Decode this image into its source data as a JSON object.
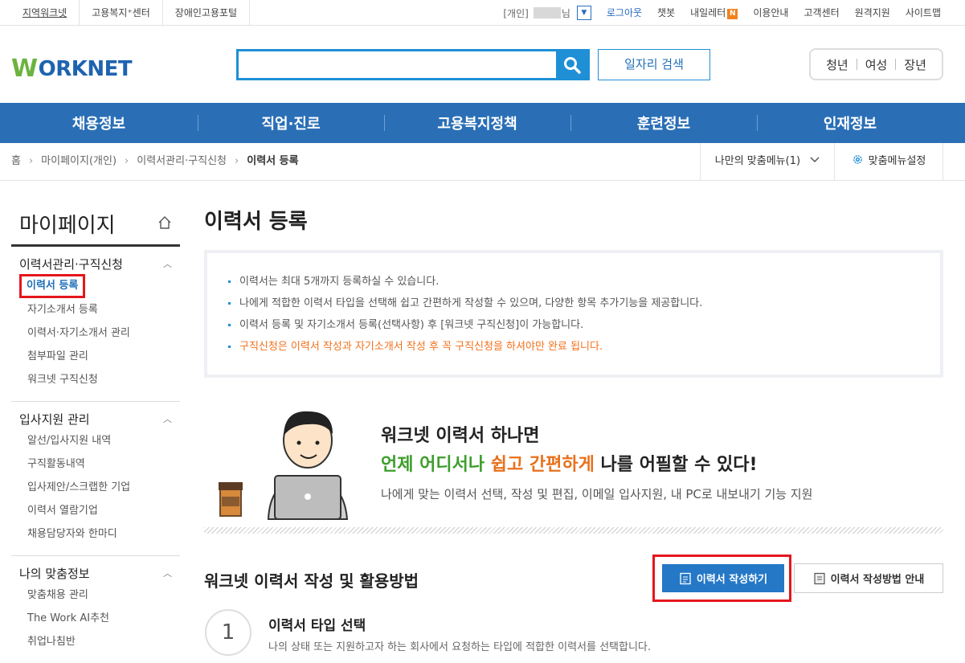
{
  "util": {
    "left_links": [
      "지역워크넷",
      "고용복지⁺센터",
      "장애인고용포털"
    ],
    "user_prefix": "[개인]",
    "user_suffix": "님",
    "logout": "로그아웃",
    "chatbot": "챗봇",
    "naeil": "내일레터",
    "naeil_badge": "N",
    "guide": "이용안내",
    "support": "고객센터",
    "remote": "원격지원",
    "sitemap": "사이트맵"
  },
  "header": {
    "logo_w": "W",
    "logo_rest": "ORKNET",
    "search_placeholder": "",
    "job_search": "일자리 검색",
    "segments": [
      "청년",
      "여성",
      "장년"
    ]
  },
  "gnb": [
    "채용정보",
    "직업·진로",
    "고용복지정책",
    "훈련정보",
    "인재정보"
  ],
  "breadcrumb": {
    "home": "홈",
    "items": [
      "마이페이지(개인)",
      "이력서관리·구직신청"
    ],
    "current": "이력서 등록",
    "my_menu": "나만의 맞춤메뉴(1)",
    "menu_settings": "맞춤메뉴설정"
  },
  "sidebar": {
    "title": "마이페이지",
    "groups": [
      {
        "title": "이력서관리·구직신청",
        "items": [
          "이력서 등록",
          "자기소개서 등록",
          "이력서·자기소개서 관리",
          "첨부파일 관리",
          "워크넷 구직신청"
        ]
      },
      {
        "title": "입사지원 관리",
        "items": [
          "알선/입사지원 내역",
          "구직활동내역",
          "입사제안/스크랩한 기업",
          "이력서 열람기업",
          "채용담당자와 한마디"
        ]
      },
      {
        "title": "나의 맞춤정보",
        "items": [
          "맞춤채용 관리",
          "The Work AI추천",
          "취업나침반"
        ]
      }
    ]
  },
  "main": {
    "title": "이력서 등록",
    "info": [
      "이력서는 최대 5개까지 등록하실 수 있습니다.",
      "나에게 적합한 이력서 타입을 선택해 쉽고 간편하게 작성할 수 있으며, 다양한 항목 추가기능을 제공합니다.",
      "이력서 등록 및 자기소개서 등록(선택사항) 후 [워크넷 구직신청]이 가능합니다."
    ],
    "warning": "구직신청은 이력서 작성과 자기소개서 작성 후 꼭 구직신청을 하셔야만 완료 됩니다.",
    "banner": {
      "line1": "워크넷 이력서 하나면",
      "line2_a": "언제 어디서나",
      "line2_b": " ",
      "line2_c": "쉽고 간편하게",
      "line2_d": " 나를 어필할 수 있다!",
      "line3": "나에게 맞는 이력서 선택, 작성 및 편집, 이메일 입사지원, 내 PC로 내보내기 기능 지원"
    },
    "section_title": "워크넷 이력서 작성 및 활용방법",
    "write_btn": "이력서 작성하기",
    "guide_btn": "이력서 작성방법 안내",
    "step": {
      "num": "1",
      "title": "이력서 타입 선택",
      "desc": "나의 상태 또는 지원하고자 하는 회사에서 요청하는 타입에 적합한 이력서를 선택합니다."
    }
  },
  "colors": {
    "brand_blue": "#2a6fb6",
    "search_blue": "#1f8fd6",
    "highlight_red": "#e5161d",
    "warn_orange": "#f2711c"
  }
}
